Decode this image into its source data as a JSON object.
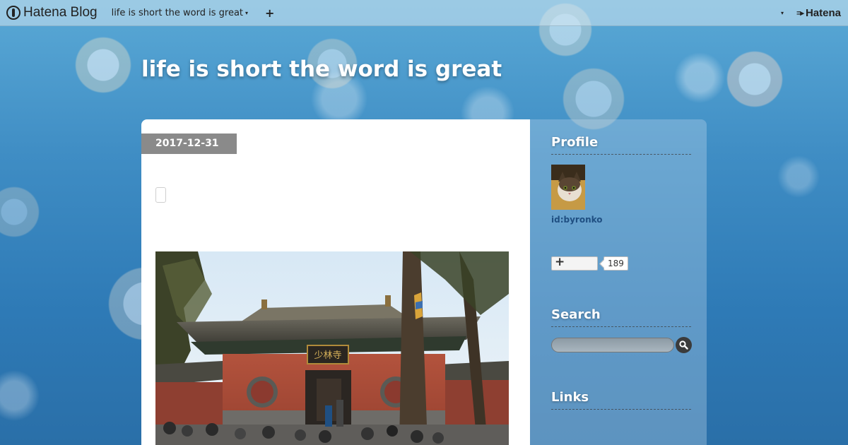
{
  "header": {
    "brand_name": "Hatena Blog",
    "blog_switch_label": "life is short the word is great",
    "new_post_symbol": "+",
    "hatena_label": "Hatena"
  },
  "blog": {
    "title": "life is short the word is great"
  },
  "entry": {
    "date": "2017-12-31",
    "photo_sign_text": "少林寺"
  },
  "sidebar": {
    "profile_title": "Profile",
    "profile_id": "id:byronko",
    "subscribe_count": "189",
    "search_title": "Search",
    "links_title": "Links"
  },
  "colors": {
    "background_blue": "#3f8dc4",
    "date_badge": "#8a8a8a",
    "profile_link": "#1f4f82"
  },
  "icons": [
    "hatena-blog-logo-icon",
    "caret-down-icon",
    "plus-icon",
    "hatena-logo-icon",
    "search-icon"
  ]
}
